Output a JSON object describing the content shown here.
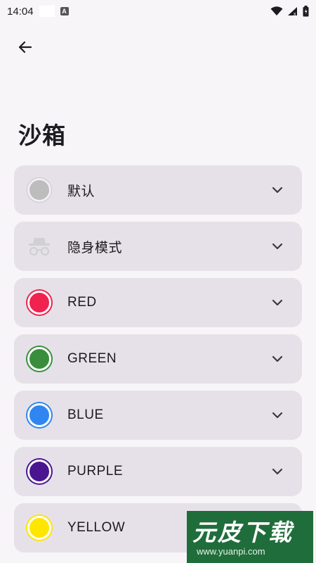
{
  "status_bar": {
    "time": "14:04",
    "notification_badge": "A"
  },
  "header": {
    "back_icon": "arrow-left-icon",
    "title": "沙箱"
  },
  "sandboxes": [
    {
      "label": "默认",
      "icon": "circle-gray",
      "color": "#bdbdbd"
    },
    {
      "label": "隐身模式",
      "icon": "incognito-icon",
      "color": "#cfcfd4"
    },
    {
      "label": "RED",
      "icon": "circle-red",
      "color": "#f0224f"
    },
    {
      "label": "GREEN",
      "icon": "circle-green",
      "color": "#388e3c"
    },
    {
      "label": "BLUE",
      "icon": "circle-blue",
      "color": "#2f86f0"
    },
    {
      "label": "PURPLE",
      "icon": "circle-purple",
      "color": "#4a1591"
    },
    {
      "label": "YELLOW",
      "icon": "circle-yellow",
      "color": "#ffe600"
    }
  ],
  "watermark": {
    "title": "元皮下载",
    "url": "www.yuanpi.com"
  },
  "colors": {
    "background": "#f7f5f8",
    "card": "#e6e1e8",
    "text": "#1c1b1f"
  }
}
